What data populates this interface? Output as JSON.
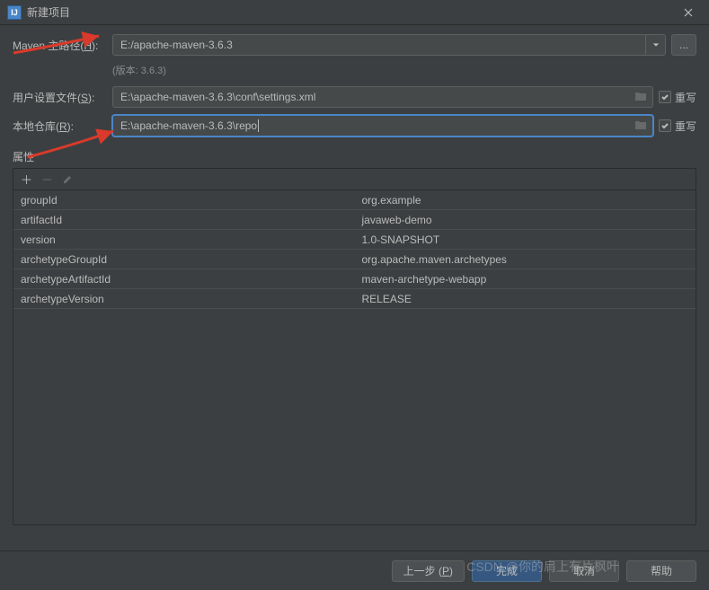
{
  "titlebar": {
    "title": "新建项目"
  },
  "form": {
    "maven_home_label_pre": "Maven 主路径(",
    "maven_home_mnemonic": "H",
    "maven_home_label_post": "):",
    "maven_home_value": "E:/apache-maven-3.6.3",
    "version_hint": "(版本: 3.6.3)",
    "user_settings_label_pre": "用户设置文件(",
    "user_settings_mnemonic": "S",
    "user_settings_label_post": "):",
    "user_settings_value": "E:\\apache-maven-3.6.3\\conf\\settings.xml",
    "local_repo_label_pre": "本地仓库(",
    "local_repo_mnemonic": "R",
    "local_repo_label_post": "):",
    "local_repo_value": "E:\\apache-maven-3.6.3\\repo",
    "override_label": "重写",
    "properties_label": "属性"
  },
  "properties": [
    {
      "key": "groupId",
      "value": "org.example"
    },
    {
      "key": "artifactId",
      "value": "javaweb-demo"
    },
    {
      "key": "version",
      "value": "1.0-SNAPSHOT"
    },
    {
      "key": "archetypeGroupId",
      "value": "org.apache.maven.archetypes"
    },
    {
      "key": "archetypeArtifactId",
      "value": "maven-archetype-webapp"
    },
    {
      "key": "archetypeVersion",
      "value": "RELEASE"
    }
  ],
  "footer": {
    "prev_pre": "上一步 (",
    "prev_mnemonic": "P",
    "prev_post": ")",
    "finish": "完成",
    "cancel": "取消",
    "help": "帮助"
  },
  "watermark": "CSDN @你的肩上有片枫叶"
}
